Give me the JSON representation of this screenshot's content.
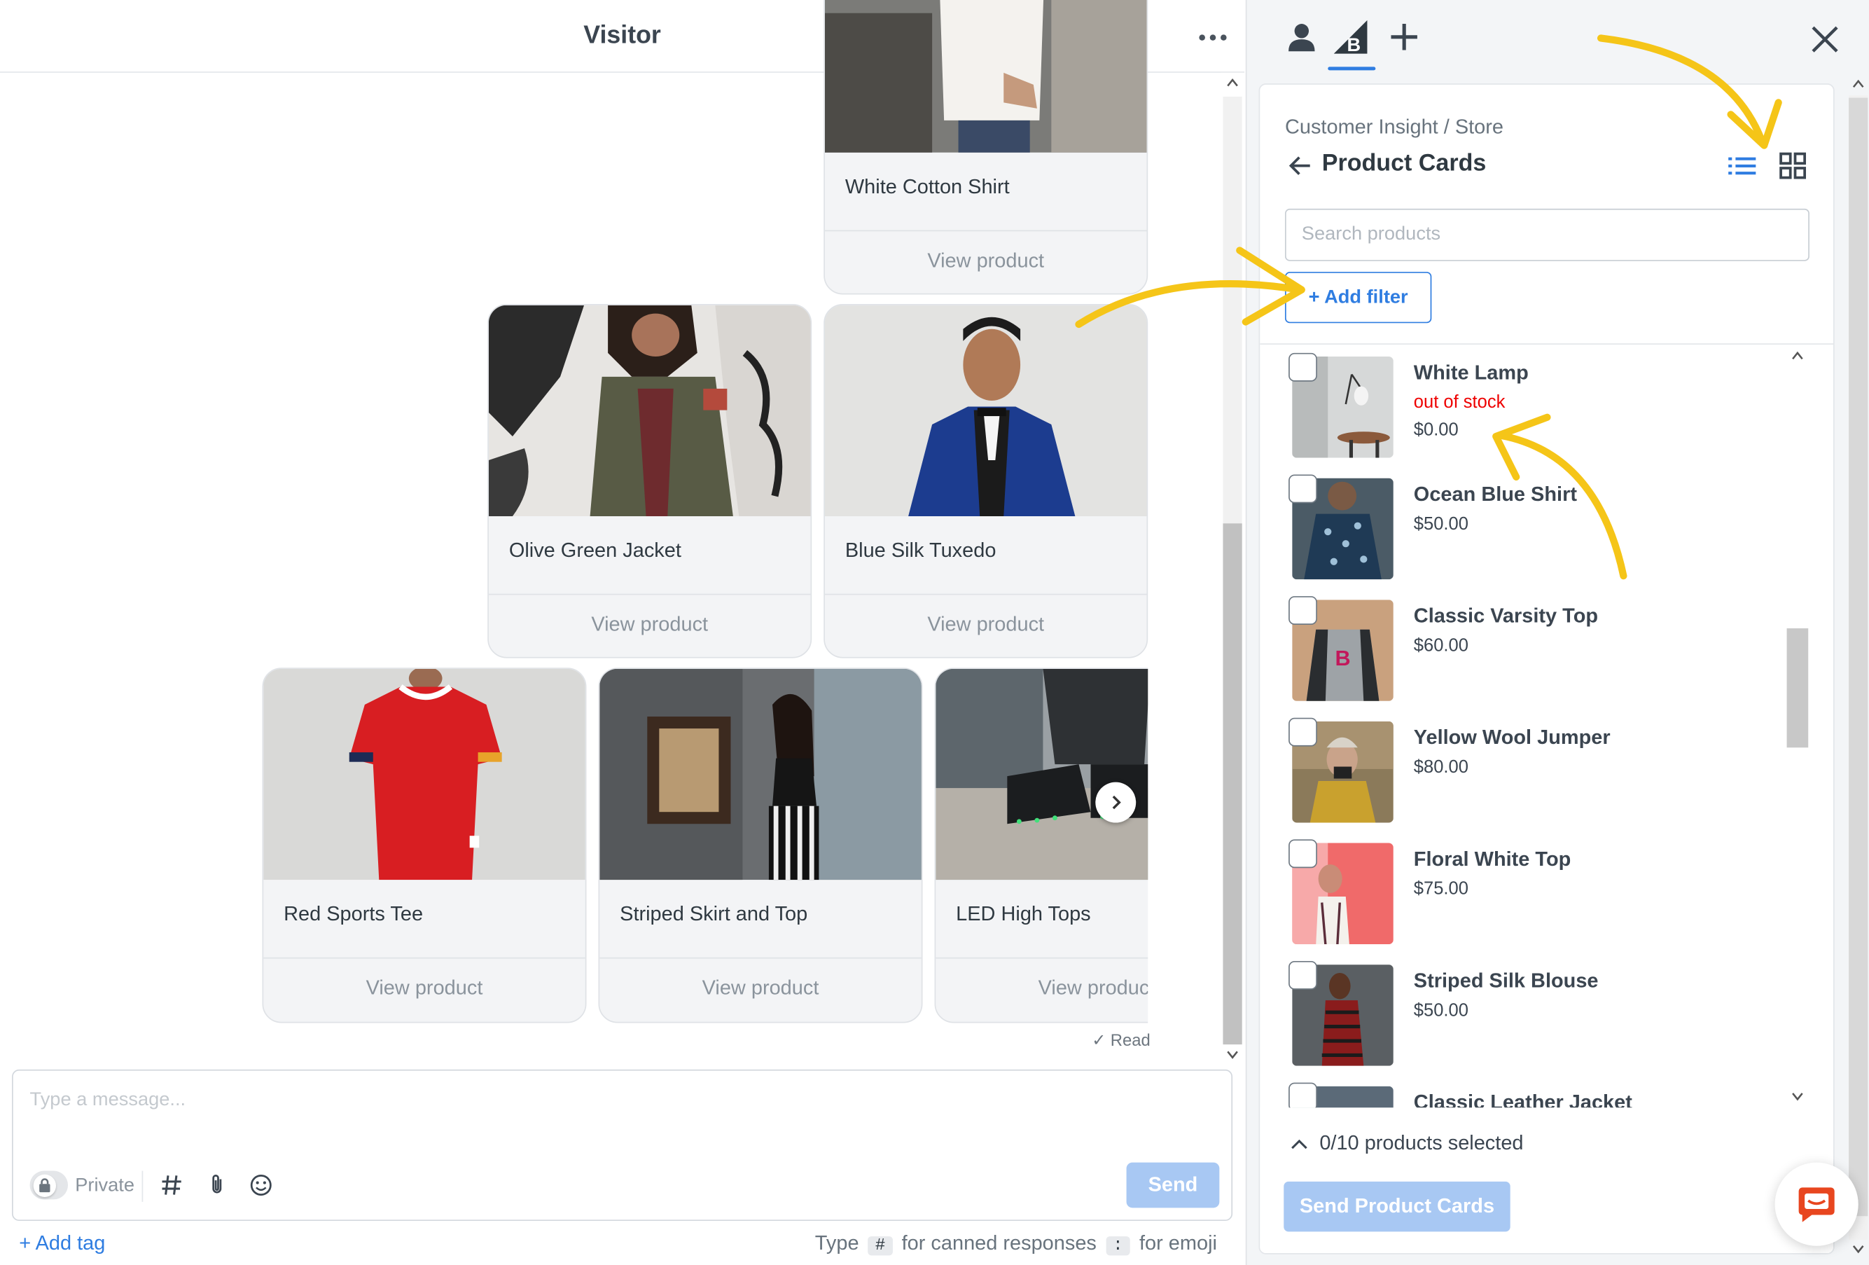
{
  "chat": {
    "header_title": "Visitor",
    "cards": [
      {
        "title": "White Cotton Shirt",
        "action": "View product"
      },
      {
        "title": "Olive Green Jacket",
        "action": "View product"
      },
      {
        "title": "Blue Silk Tuxedo",
        "action": "View product"
      },
      {
        "title": "Red Sports Tee",
        "action": "View product"
      },
      {
        "title": "Striped Skirt and Top",
        "action": "View product"
      },
      {
        "title": "LED High Tops",
        "action": "View produc"
      }
    ],
    "read_receipt": "✓ Read",
    "composer": {
      "placeholder": "Type a message...",
      "private_label": "Private",
      "send_label": "Send"
    },
    "add_tag": "+ Add tag",
    "hint": {
      "type": "Type",
      "hash_key": "#",
      "canned": "for canned responses",
      "colon_key": ":",
      "emoji": "for emoji"
    }
  },
  "panel": {
    "breadcrumb": "Customer Insight / Store",
    "title": "Product Cards",
    "search_placeholder": "Search products",
    "add_filter": "+ Add filter",
    "products": [
      {
        "name": "White Lamp",
        "stock": "out of stock",
        "price": "$0.00"
      },
      {
        "name": "Ocean Blue Shirt",
        "price": "$50.00"
      },
      {
        "name": "Classic Varsity Top",
        "price": "$60.00"
      },
      {
        "name": "Yellow Wool Jumper",
        "price": "$80.00"
      },
      {
        "name": "Floral White Top",
        "price": "$75.00"
      },
      {
        "name": "Striped Silk Blouse",
        "price": "$50.00"
      },
      {
        "name": "Classic Leather Jacket",
        "price": ""
      }
    ],
    "selected_text": "0/10 products selected",
    "send_button": "Send Product Cards"
  },
  "colors": {
    "accent": "#2f7de1",
    "disabled_button": "#a8c8f3",
    "out_of_stock": "#e00000",
    "annotation_arrow": "#f5c518",
    "launcher": "#e8461f"
  },
  "icons": [
    "more-icon",
    "person-icon",
    "bigcommerce-icon",
    "plus-icon",
    "close-icon",
    "back-arrow-icon",
    "list-view-icon",
    "grid-view-icon",
    "lock-icon",
    "hash-icon",
    "paperclip-icon",
    "emoji-icon",
    "chevron-up-icon",
    "chevron-right-icon",
    "chat-launcher-icon"
  ]
}
